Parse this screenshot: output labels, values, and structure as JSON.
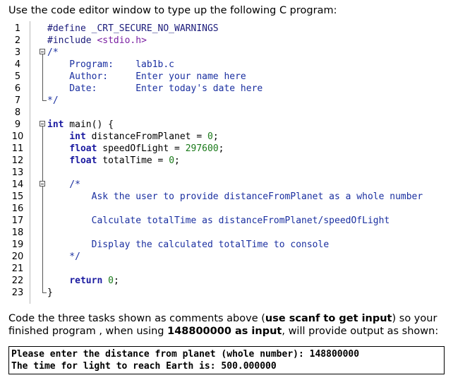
{
  "instruction_top": "Use the code editor window to type up the following C program:",
  "editor": {
    "line_numbers": [
      "1",
      "2",
      "3",
      "4",
      "5",
      "6",
      "7",
      "8",
      "9",
      "10",
      "11",
      "12",
      "13",
      "14",
      "15",
      "16",
      "17",
      "18",
      "19",
      "20",
      "21",
      "22",
      "23"
    ],
    "lines": [
      {
        "tokens": [
          {
            "t": "#define _CRT_SECURE_NO_WARNINGS",
            "c": "pp"
          }
        ]
      },
      {
        "tokens": [
          {
            "t": "#include ",
            "c": "pp"
          },
          {
            "t": "<stdio.h>",
            "c": "inc"
          }
        ]
      },
      {
        "tokens": [
          {
            "t": "/*",
            "c": "cm"
          }
        ]
      },
      {
        "tokens": [
          {
            "t": "    Program:    lab1b.c",
            "c": "cm"
          }
        ]
      },
      {
        "tokens": [
          {
            "t": "    Author:     Enter your name here",
            "c": "cm"
          }
        ]
      },
      {
        "tokens": [
          {
            "t": "    Date:       Enter today's date here",
            "c": "cm"
          }
        ]
      },
      {
        "tokens": [
          {
            "t": "*/",
            "c": "cm"
          }
        ]
      },
      {
        "tokens": []
      },
      {
        "tokens": [
          {
            "t": "int",
            "c": "kw"
          },
          {
            "t": " main() {",
            "c": "plain"
          }
        ]
      },
      {
        "tokens": [
          {
            "t": "    ",
            "c": "plain"
          },
          {
            "t": "int",
            "c": "kw"
          },
          {
            "t": " distanceFromPlanet = ",
            "c": "plain"
          },
          {
            "t": "0",
            "c": "num"
          },
          {
            "t": ";",
            "c": "plain"
          }
        ]
      },
      {
        "tokens": [
          {
            "t": "    ",
            "c": "plain"
          },
          {
            "t": "float",
            "c": "kw"
          },
          {
            "t": " speedOfLight = ",
            "c": "plain"
          },
          {
            "t": "297600",
            "c": "num"
          },
          {
            "t": ";",
            "c": "plain"
          }
        ]
      },
      {
        "tokens": [
          {
            "t": "    ",
            "c": "plain"
          },
          {
            "t": "float",
            "c": "kw"
          },
          {
            "t": " totalTime = ",
            "c": "plain"
          },
          {
            "t": "0",
            "c": "num"
          },
          {
            "t": ";",
            "c": "plain"
          }
        ]
      },
      {
        "tokens": []
      },
      {
        "tokens": [
          {
            "t": "    /*",
            "c": "cm"
          }
        ]
      },
      {
        "tokens": [
          {
            "t": "        Ask the user to provide distanceFromPlanet as a whole number",
            "c": "cm"
          }
        ]
      },
      {
        "tokens": []
      },
      {
        "tokens": [
          {
            "t": "        Calculate totalTime as distanceFromPlanet/speedOfLight",
            "c": "cm"
          }
        ]
      },
      {
        "tokens": []
      },
      {
        "tokens": [
          {
            "t": "        Display the calculated totalTime to console",
            "c": "cm"
          }
        ]
      },
      {
        "tokens": [
          {
            "t": "    */",
            "c": "cm"
          }
        ]
      },
      {
        "tokens": []
      },
      {
        "tokens": [
          {
            "t": "    ",
            "c": "plain"
          },
          {
            "t": "return",
            "c": "kw"
          },
          {
            "t": " ",
            "c": "plain"
          },
          {
            "t": "0",
            "c": "num"
          },
          {
            "t": ";",
            "c": "plain"
          }
        ]
      },
      {
        "tokens": [
          {
            "t": "}",
            "c": "plain"
          }
        ]
      }
    ]
  },
  "instruction_bottom": {
    "part1": "Code the three tasks shown as comments above (",
    "bold1": "use scanf to get input",
    "part2": ") so your finished program , when using ",
    "bold2": "148800000 as input",
    "part3": ", will provide output as shown:"
  },
  "output": {
    "line1": "Please enter the distance from planet (whole number): 148800000",
    "line2": "The time for light to reach Earth is: 500.000000"
  }
}
